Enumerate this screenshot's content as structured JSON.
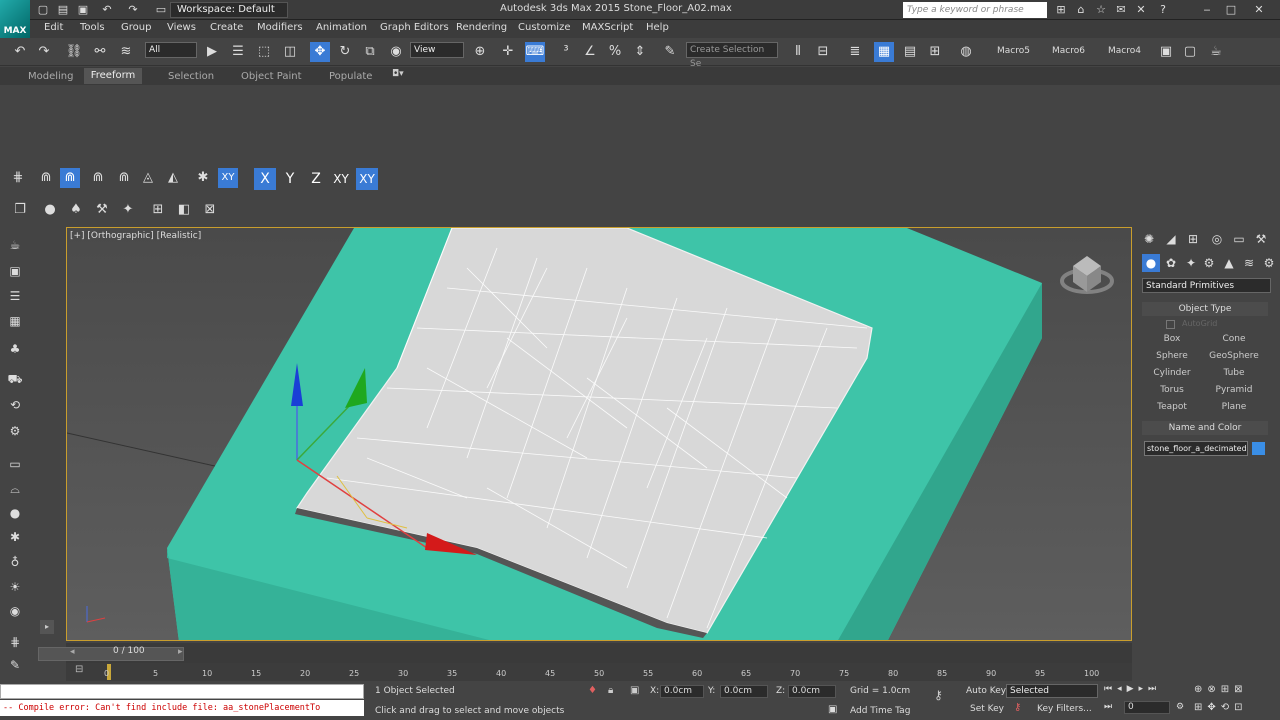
{
  "title_bar": {
    "workspace": "Workspace: Default",
    "window_title": "Autodesk 3ds Max 2015    Stone_Floor_A02.max",
    "search_placeholder": "Type a keyword or phrase"
  },
  "menu": {
    "items": [
      "Edit",
      "Tools",
      "Group",
      "Views",
      "Create",
      "Modifiers",
      "Animation",
      "Graph Editors",
      "Rendering",
      "Customize",
      "MAXScript",
      "Help"
    ]
  },
  "toolbar": {
    "selection_filter": "All",
    "ref_coord": "View",
    "named_selection": "Create Selection Se",
    "macros": [
      "Macro5",
      "Macro6",
      "Macro4"
    ]
  },
  "ribbon": {
    "tabs": [
      "Modeling",
      "Freeform",
      "Selection",
      "Object Paint",
      "Populate"
    ],
    "active_tab": "Freeform"
  },
  "snap_toolbar": {
    "axes": [
      "X",
      "Y",
      "Z",
      "XY",
      "XY"
    ]
  },
  "viewport": {
    "label": "[+] [Orthographic] [Realistic]"
  },
  "command_panel": {
    "category": "Standard Primitives",
    "object_type_header": "Object Type",
    "autogrid": "AutoGrid",
    "buttons": [
      "Box",
      "Cone",
      "Sphere",
      "GeoSphere",
      "Cylinder",
      "Tube",
      "Torus",
      "Pyramid",
      "Teapot",
      "Plane"
    ],
    "name_color_header": "Name and Color",
    "object_name": "stone_floor_a_decimated",
    "color": "#3a8ee6"
  },
  "timeline": {
    "position_label": "0 / 100",
    "ticks": [
      "0",
      "5",
      "10",
      "15",
      "20",
      "25",
      "30",
      "35",
      "40",
      "45",
      "50",
      "55",
      "60",
      "65",
      "70",
      "75",
      "80",
      "85",
      "90",
      "95",
      "100"
    ]
  },
  "status": {
    "maxscript_error": "-- Compile error: Can't find include file:  aa_stonePlacementTo",
    "selection_count": "1 Object Selected",
    "prompt": "Click and drag to select and move objects",
    "x_label": "X:",
    "x_value": "0.0cm",
    "y_label": "Y:",
    "y_value": "0.0cm",
    "z_label": "Z:",
    "z_value": "0.0cm",
    "grid": "Grid = 1.0cm",
    "add_time_tag": "Add Time Tag",
    "auto_key": "Auto Key",
    "set_key": "Set Key",
    "key_mode": "Selected",
    "key_filters": "Key Filters...",
    "current_frame": "0"
  }
}
